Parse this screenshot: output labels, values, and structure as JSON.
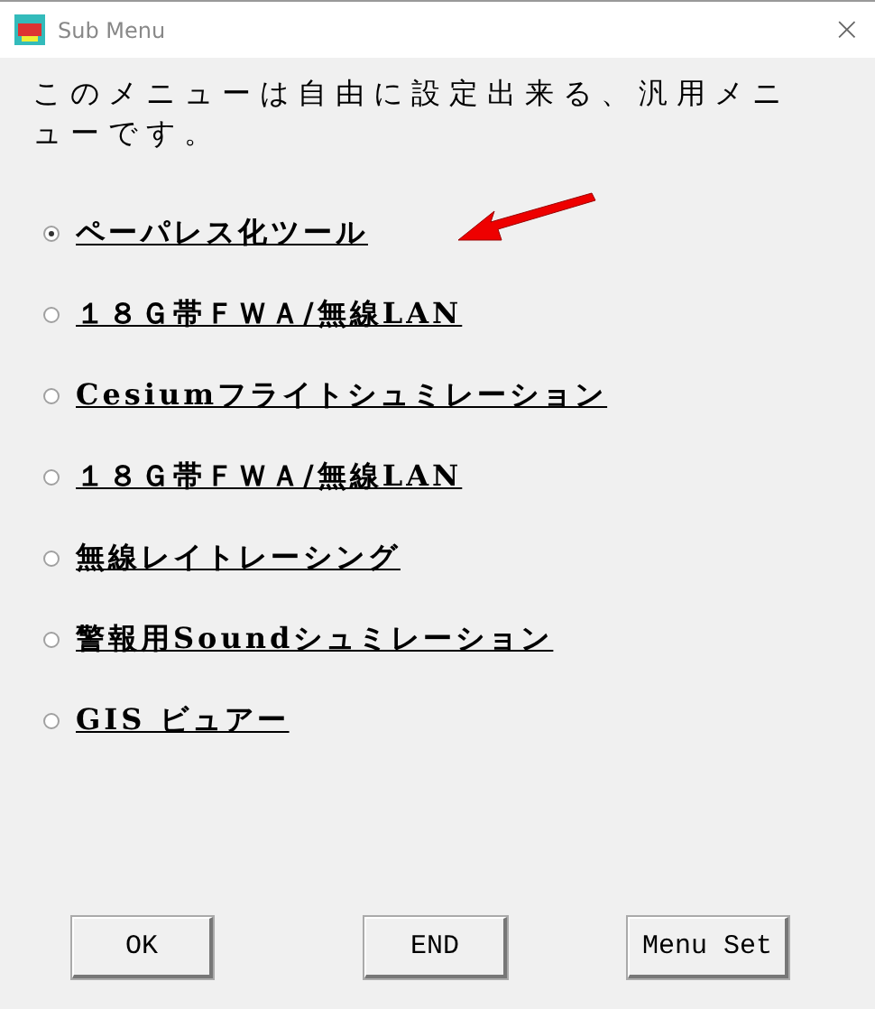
{
  "window": {
    "title": "Sub Menu",
    "close": "×"
  },
  "description": "このメニューは自由に設定出来る、汎用メニューです。",
  "options": [
    {
      "label": "ペーパレス化ツール",
      "selected": true
    },
    {
      "label": "１８Ｇ帯ＦＷＡ/無線LAN",
      "selected": false
    },
    {
      "label": "Cesiumフライトシュミレーション",
      "selected": false
    },
    {
      "label": "１８Ｇ帯ＦＷＡ/無線LAN",
      "selected": false
    },
    {
      "label": "無線レイトレーシング",
      "selected": false
    },
    {
      "label": "警報用Soundシュミレーション",
      "selected": false
    },
    {
      "label": "GIS ビュアー",
      "selected": false
    }
  ],
  "buttons": [
    "OK",
    "END",
    "Menu Set"
  ]
}
